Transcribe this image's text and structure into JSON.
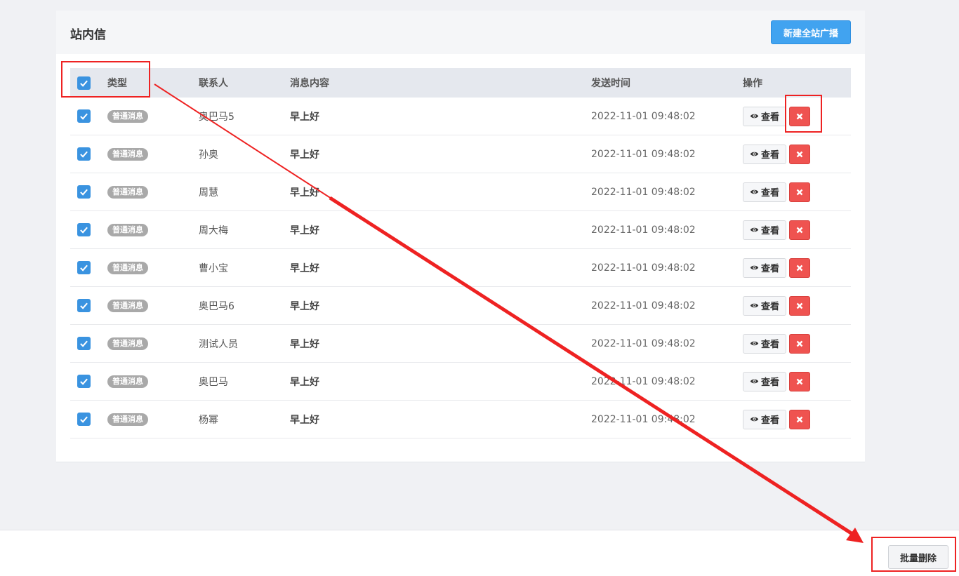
{
  "panel": {
    "title": "站内信",
    "new_broadcast_label": "新建全站广播"
  },
  "table": {
    "headers": {
      "type": "类型",
      "contact": "联系人",
      "content": "消息内容",
      "time": "发送时间",
      "ops": "操作"
    },
    "rows": [
      {
        "type": "普通消息",
        "contact": "奥巴马5",
        "content": "早上好",
        "time": "2022-11-01 09:48:02"
      },
      {
        "type": "普通消息",
        "contact": "孙奥",
        "content": "早上好",
        "time": "2022-11-01 09:48:02"
      },
      {
        "type": "普通消息",
        "contact": "周慧",
        "content": "早上好",
        "time": "2022-11-01 09:48:02"
      },
      {
        "type": "普通消息",
        "contact": "周大梅",
        "content": "早上好",
        "time": "2022-11-01 09:48:02"
      },
      {
        "type": "普通消息",
        "contact": "曹小宝",
        "content": "早上好",
        "time": "2022-11-01 09:48:02"
      },
      {
        "type": "普通消息",
        "contact": "奥巴马6",
        "content": "早上好",
        "time": "2022-11-01 09:48:02"
      },
      {
        "type": "普通消息",
        "contact": "测试人员",
        "content": "早上好",
        "time": "2022-11-01 09:48:02"
      },
      {
        "type": "普通消息",
        "contact": "奥巴马",
        "content": "早上好",
        "time": "2022-11-01 09:48:02"
      },
      {
        "type": "普通消息",
        "contact": "杨幂",
        "content": "早上好",
        "time": "2022-11-01 09:48:02"
      }
    ],
    "view_label": "查看",
    "icons": {
      "view": "eye-icon",
      "delete": "close-icon",
      "check": "check-icon"
    }
  },
  "footer": {
    "batch_delete_label": "批量删除"
  },
  "colors": {
    "primary": "#41a3f0",
    "danger": "#ef5350",
    "checkbox": "#3a93e0",
    "annotation": "#ee2222"
  }
}
